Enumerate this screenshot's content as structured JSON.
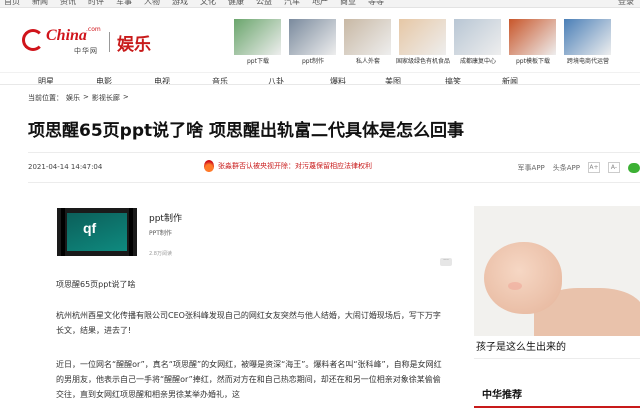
{
  "topbar": {
    "links": [
      "首页",
      "新闻",
      "资讯",
      "时评",
      "军事",
      "人物",
      "游戏",
      "文化",
      "健康",
      "公益",
      "汽车",
      "地产",
      "商业",
      "等等"
    ],
    "right": "登录"
  },
  "logo": {
    "text": "China",
    "com": ".com",
    "cn": "中华网",
    "channel": "娱乐"
  },
  "promos": [
    {
      "caption": "ppt下载",
      "color": "#6aa56c"
    },
    {
      "caption": "ppt制作",
      "color": "#7a8a9d"
    },
    {
      "caption": "私人外套",
      "color": "#c8b8a4"
    },
    {
      "caption": "国家级绿色有机食品",
      "color": "#e6c7a5"
    },
    {
      "caption": "成都康复中心",
      "color": "#b8c6d4"
    },
    {
      "caption": "ppt模板下载",
      "color": "#c8562a"
    },
    {
      "caption": "跨境电商代运营",
      "color": "#4a7fb7"
    }
  ],
  "nav": [
    "明星",
    "电影",
    "电视",
    "音乐",
    "八卦",
    "爆料",
    "美图",
    "搞笑",
    "新闻"
  ],
  "breadcrumb": {
    "prefix": "当前位置：",
    "items": [
      "娱乐",
      ">",
      "影视长廊",
      ">"
    ]
  },
  "article": {
    "title": "项思醒65页ppt说了啥 项思醒出轨富二代具体是怎么回事",
    "datetime": "2021-04-14 14:47:04",
    "hot_news": "张淼群否认被央视开除：对污蔑保留相应法律权利",
    "app1": "军事APP",
    "app2": "头条APP",
    "font_small": "A-",
    "font_large": "A+"
  },
  "promo_card": {
    "name": "ppt制作",
    "sub": "PPT制作",
    "reads": "2.8万阅读",
    "logo_text": "qf",
    "more": "···"
  },
  "paragraphs": [
    "项思醒65页ppt说了啥",
    "杭州杭州酉星文化传播有限公司CEO张科峰发现自己的网红女友突然与他人结婚，大闹订婚现场后，写下万字长文，结果，进去了!",
    "近日，一位网名“醒醒or”，真名“项思醒”的女网红，被曝是资深“海王”。爆料者名叫“张科峰”，自称是女网红的男朋友，他表示自己一手将“醒醒or”捧红，然而对方在和自己热恋期间，却还在和另一位相亲对象徐某偷偷交往，直到女网红项思醒和相亲男徐某举办婚礼，这"
  ],
  "sidebar": {
    "image_caption": "孩子是这么生出来的",
    "heading": "中华推荐"
  }
}
